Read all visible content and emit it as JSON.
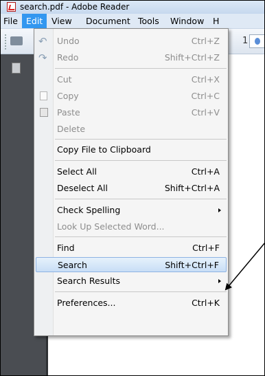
{
  "window": {
    "title": "search.pdf - Adobe Reader"
  },
  "menubar": [
    "File",
    "Edit",
    "View",
    "Document",
    "Tools",
    "Window",
    "H"
  ],
  "toolbar": {
    "page_number": "1"
  },
  "edit_menu": {
    "undo": {
      "label": "Undo",
      "shortcut": "Ctrl+Z"
    },
    "redo": {
      "label": "Redo",
      "shortcut": "Shift+Ctrl+Z"
    },
    "cut": {
      "label": "Cut",
      "shortcut": "Ctrl+X"
    },
    "copy": {
      "label": "Copy",
      "shortcut": "Ctrl+C"
    },
    "paste": {
      "label": "Paste",
      "shortcut": "Ctrl+V"
    },
    "delete": {
      "label": "Delete"
    },
    "copy_file": {
      "label": "Copy File to Clipboard"
    },
    "select_all": {
      "label": "Select All",
      "shortcut": "Ctrl+A"
    },
    "deselect_all": {
      "label": "Deselect All",
      "shortcut": "Shift+Ctrl+A"
    },
    "check_spelling": {
      "label": "Check Spelling"
    },
    "look_up": {
      "label": "Look Up Selected Word..."
    },
    "find": {
      "label": "Find",
      "shortcut": "Ctrl+F"
    },
    "search": {
      "label": "Search",
      "shortcut": "Shift+Ctrl+F"
    },
    "search_results": {
      "label": "Search Results"
    },
    "preferences": {
      "label": "Preferences...",
      "shortcut": "Ctrl+K"
    }
  },
  "icons": {
    "app": "adobe-reader-icon",
    "print": "printer-icon",
    "pages_panel": "pages-panel-icon",
    "undo": "undo-arrow-icon",
    "redo": "redo-arrow-icon",
    "copy": "copy-icon",
    "paste": "paste-icon"
  },
  "colors": {
    "menu_active": "#3297f0",
    "highlight": "#c8def6",
    "left_pane": "#4a4d52",
    "disabled_text": "#8d8d8d"
  }
}
